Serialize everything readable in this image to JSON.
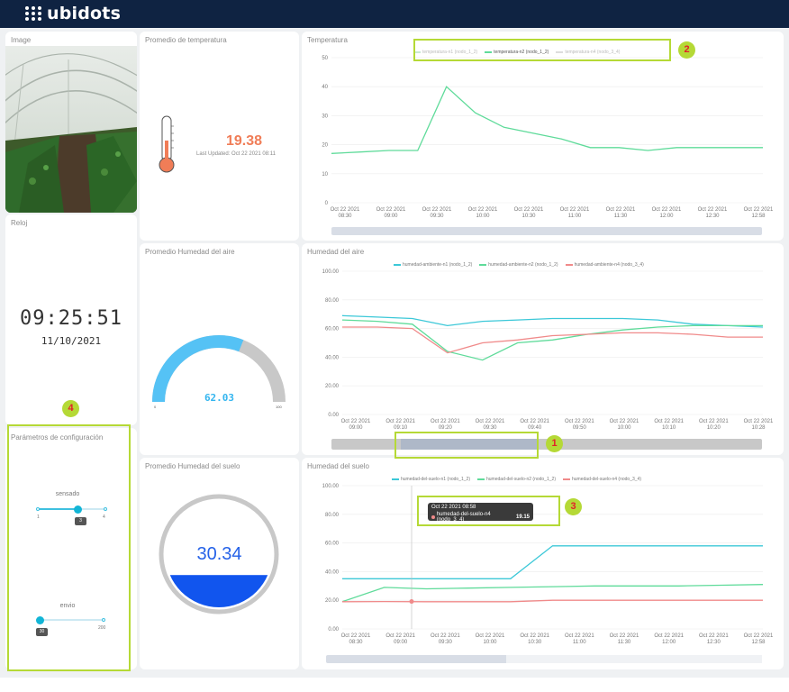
{
  "header": {
    "logo_text": "ubidots"
  },
  "cards": {
    "image": {
      "title": "Image"
    },
    "clock": {
      "title": "Reloj",
      "time": "09:25:51",
      "date": "11/10/2021"
    },
    "config": {
      "title": "Parámetros de configuración",
      "sliders": [
        {
          "label": "sensado",
          "min": "1",
          "max": "4",
          "value": "3",
          "fraction": 0.67
        },
        {
          "label": "envio",
          "min": "30",
          "max": "200",
          "value": "30",
          "fraction": 0.0
        }
      ]
    },
    "temp_avg": {
      "title": "Promedio de temperatura",
      "value": "19.38",
      "updated": "Last Updated: Oct 22 2021 08:11"
    },
    "hum_air_avg": {
      "title": "Promedio Humedad del aire",
      "value": "62.03",
      "min": "0",
      "max": "100",
      "fraction": 0.6203
    },
    "hum_soil_avg": {
      "title": "Promedio Humedad del suelo",
      "value": "30.34",
      "fill_fraction": 0.3034
    }
  },
  "colors": {
    "header_bg": "#0f2342",
    "teal": "#3cc8d8",
    "green": "#5fdb9a",
    "red": "#f08a8a",
    "gauge_blue": "#55c2f5",
    "soil_blue": "#1155ee",
    "temp_orange": "#f07d57",
    "highlight": "#b5d936"
  },
  "charts": {
    "temperatura": {
      "title": "Temperatura",
      "legend": [
        "temperatura-n1 (nodo_1_2)",
        "temperatura-n2 (nodo_1_2)",
        "temperatura-n4 (nodo_3_4)"
      ],
      "yticks": [
        "0",
        "10",
        "20",
        "30",
        "40",
        "50"
      ],
      "xticks": [
        [
          "Oct 22 2021",
          "08:30"
        ],
        [
          "Oct 22 2021",
          "09:00"
        ],
        [
          "Oct 22 2021",
          "09:30"
        ],
        [
          "Oct 22 2021",
          "10:00"
        ],
        [
          "Oct 22 2021",
          "10:30"
        ],
        [
          "Oct 22 2021",
          "11:00"
        ],
        [
          "Oct 22 2021",
          "11:30"
        ],
        [
          "Oct 22 2021",
          "12:00"
        ],
        [
          "Oct 22 2021",
          "12:30"
        ],
        [
          "Oct 22 2021",
          "12:58"
        ]
      ]
    },
    "humedad_aire": {
      "title": "Humedad del aire",
      "legend": [
        "humedad-ambiente-n1 (nodo_1_2)",
        "humedad-ambiente-n2 (nodo_1_2)",
        "humedad-ambiente-n4 (nodo_3_4)"
      ],
      "yticks": [
        "0.00",
        "20.00",
        "40.00",
        "60.00",
        "80.00",
        "100.00"
      ],
      "xticks": [
        [
          "Oct 22 2021",
          "09:00"
        ],
        [
          "Oct 22 2021",
          "09:10"
        ],
        [
          "Oct 22 2021",
          "09:20"
        ],
        [
          "Oct 22 2021",
          "09:30"
        ],
        [
          "Oct 22 2021",
          "09:40"
        ],
        [
          "Oct 22 2021",
          "09:50"
        ],
        [
          "Oct 22 2021",
          "10:00"
        ],
        [
          "Oct 22 2021",
          "10:10"
        ],
        [
          "Oct 22 2021",
          "10:20"
        ],
        [
          "Oct 22 2021",
          "10:28"
        ]
      ]
    },
    "humedad_suelo": {
      "title": "Humedad del suelo",
      "legend": [
        "humedad-del-suelo-n1 (nodo_1_2)",
        "humedad-del-suelo-n2 (nodo_1_2)",
        "humedad-del-suelo-n4 (nodo_3_4)"
      ],
      "yticks": [
        "0.00",
        "20.00",
        "40.00",
        "60.00",
        "80.00",
        "100.00"
      ],
      "xticks": [
        [
          "Oct 22 2021",
          "08:30"
        ],
        [
          "Oct 22 2021",
          "09:00"
        ],
        [
          "Oct 22 2021",
          "09:30"
        ],
        [
          "Oct 22 2021",
          "10:00"
        ],
        [
          "Oct 22 2021",
          "10:30"
        ],
        [
          "Oct 22 2021",
          "11:00"
        ],
        [
          "Oct 22 2021",
          "11:30"
        ],
        [
          "Oct 22 2021",
          "12:00"
        ],
        [
          "Oct 22 2021",
          "12:30"
        ],
        [
          "Oct 22 2021",
          "12:58"
        ]
      ],
      "tooltip": {
        "date": "Oct 22 2021 08:58",
        "series": "humedad-del-suelo-n4 (nodo_3_4)",
        "value": "19.15"
      }
    }
  },
  "annotations": {
    "badge1": "1",
    "badge2": "2",
    "badge3": "3",
    "badge4": "4"
  },
  "chart_data": [
    {
      "type": "line",
      "title": "Temperatura",
      "ylim": [
        0,
        50
      ],
      "x": [
        "08:30",
        "08:45",
        "09:00",
        "09:05",
        "09:08",
        "09:12",
        "09:18",
        "09:30",
        "09:45",
        "10:00",
        "10:30",
        "11:00",
        "11:30",
        "12:00",
        "12:30",
        "12:58"
      ],
      "series": [
        {
          "name": "temperatura-n2 (nodo_1_2)",
          "values": [
            17,
            17.5,
            18,
            18,
            40,
            31,
            26,
            24,
            22,
            19,
            19,
            18,
            19,
            19,
            19,
            19
          ]
        }
      ]
    },
    {
      "type": "line",
      "title": "Humedad del aire",
      "ylim": [
        0,
        100
      ],
      "x": [
        "09:00",
        "09:10",
        "09:12",
        "09:15",
        "09:20",
        "09:25",
        "09:30",
        "09:40",
        "09:50",
        "10:00",
        "10:10",
        "10:20",
        "10:28"
      ],
      "series": [
        {
          "name": "humedad-ambiente-n1 (nodo_1_2)",
          "values": [
            69,
            68,
            67,
            62,
            65,
            66,
            67,
            67,
            67,
            66,
            63,
            62,
            61
          ]
        },
        {
          "name": "humedad-ambiente-n2 (nodo_1_2)",
          "values": [
            66,
            65,
            63,
            44,
            38,
            50,
            52,
            56,
            59,
            61,
            62,
            62,
            62
          ]
        },
        {
          "name": "humedad-ambiente-n4 (nodo_3_4)",
          "values": [
            61,
            61,
            60,
            43,
            50,
            52,
            55,
            56,
            57,
            57,
            56,
            54,
            54
          ]
        }
      ]
    },
    {
      "type": "line",
      "title": "Humedad del suelo",
      "ylim": [
        0,
        100
      ],
      "x": [
        "08:30",
        "09:00",
        "09:30",
        "10:00",
        "10:25",
        "10:30",
        "11:00",
        "11:30",
        "12:00",
        "12:30",
        "12:58"
      ],
      "series": [
        {
          "name": "humedad-del-suelo-n1 (nodo_1_2)",
          "values": [
            35,
            35,
            35,
            35,
            35,
            58,
            58,
            58,
            58,
            58,
            58
          ]
        },
        {
          "name": "humedad-del-suelo-n2 (nodo_1_2)",
          "values": [
            19,
            29,
            28,
            28.5,
            29,
            29.5,
            30,
            30,
            30,
            30.5,
            31
          ]
        },
        {
          "name": "humedad-del-suelo-n4 (nodo_3_4)",
          "values": [
            19,
            19.15,
            19,
            19,
            19,
            20,
            20,
            20,
            20,
            20,
            20
          ]
        }
      ]
    }
  ]
}
